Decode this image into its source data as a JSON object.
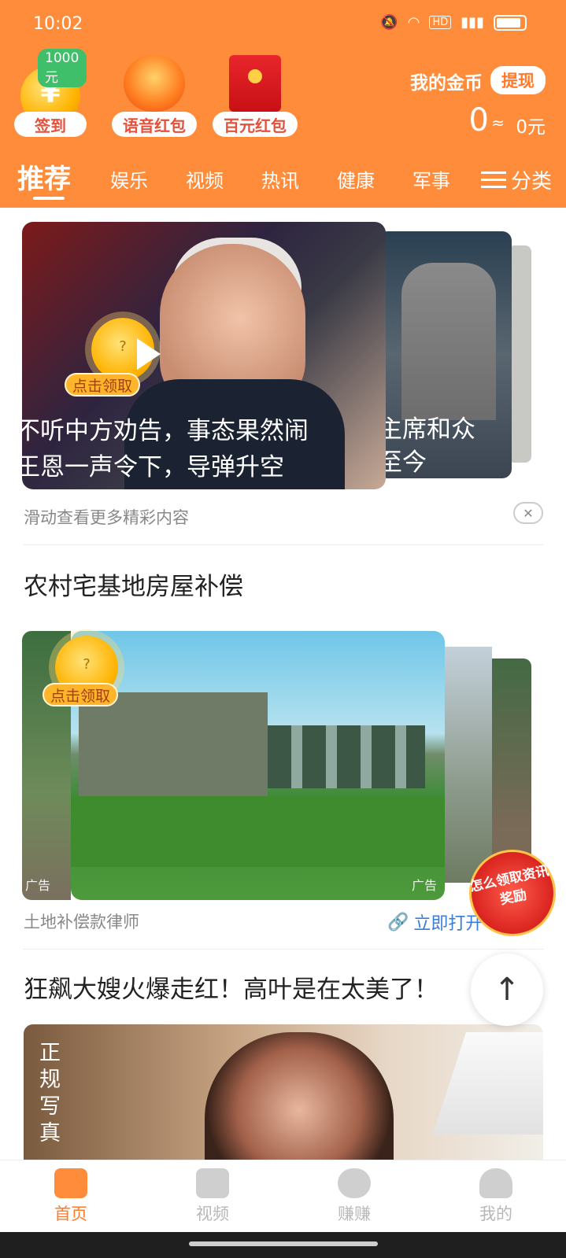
{
  "status_bar": {
    "time": "10:02",
    "icons": [
      "mute-icon",
      "wifi-icon",
      "hd-icon",
      "5g-signal-icon",
      "battery-icon"
    ]
  },
  "rewards": [
    {
      "label": "签到",
      "badge": "1000元",
      "icon": "coin-yen-icon"
    },
    {
      "label": "语音红包",
      "icon": "red-envelope-hat-icon"
    },
    {
      "label": "百元红包",
      "icon": "red-envelope-icon"
    }
  ],
  "coins": {
    "title": "我的金币",
    "withdraw": "提现",
    "amount": "0",
    "approx": "≈",
    "yuan": "0元"
  },
  "tabs": [
    {
      "label": "推荐",
      "active": true
    },
    {
      "label": "娱乐"
    },
    {
      "label": "视频"
    },
    {
      "label": "热讯"
    },
    {
      "label": "健康"
    },
    {
      "label": "军事"
    }
  ],
  "category_label": "分类",
  "feed": {
    "carousel1": {
      "main_line1": "不听中方劝告，事态果然闹",
      "main_line2": "王恩一声令下，导弹升空",
      "side_line1": "主席和众",
      "side_line2": "至今",
      "reward_label": "点击领取",
      "hint": "滑动查看更多精彩内容"
    },
    "ad1": {
      "title": "农村宅基地房屋补偿",
      "reward_label": "点击领取",
      "ad_tag": "广告",
      "source": "土地补偿款律师",
      "open_label": "立即打开"
    },
    "article3": {
      "title": "狂飙大嫂火爆走红！高叶是在太美了！",
      "vertical_text": "正规写真"
    }
  },
  "float_promo": "怎么领取资讯奖励",
  "back_to_top": "↑",
  "bottom_nav": [
    {
      "label": "首页",
      "active": true
    },
    {
      "label": "视频"
    },
    {
      "label": "赚赚"
    },
    {
      "label": "我的"
    }
  ],
  "colors": {
    "brand": "#ff8c3a",
    "link": "#3b7bd9",
    "reward": "#ffb300"
  }
}
